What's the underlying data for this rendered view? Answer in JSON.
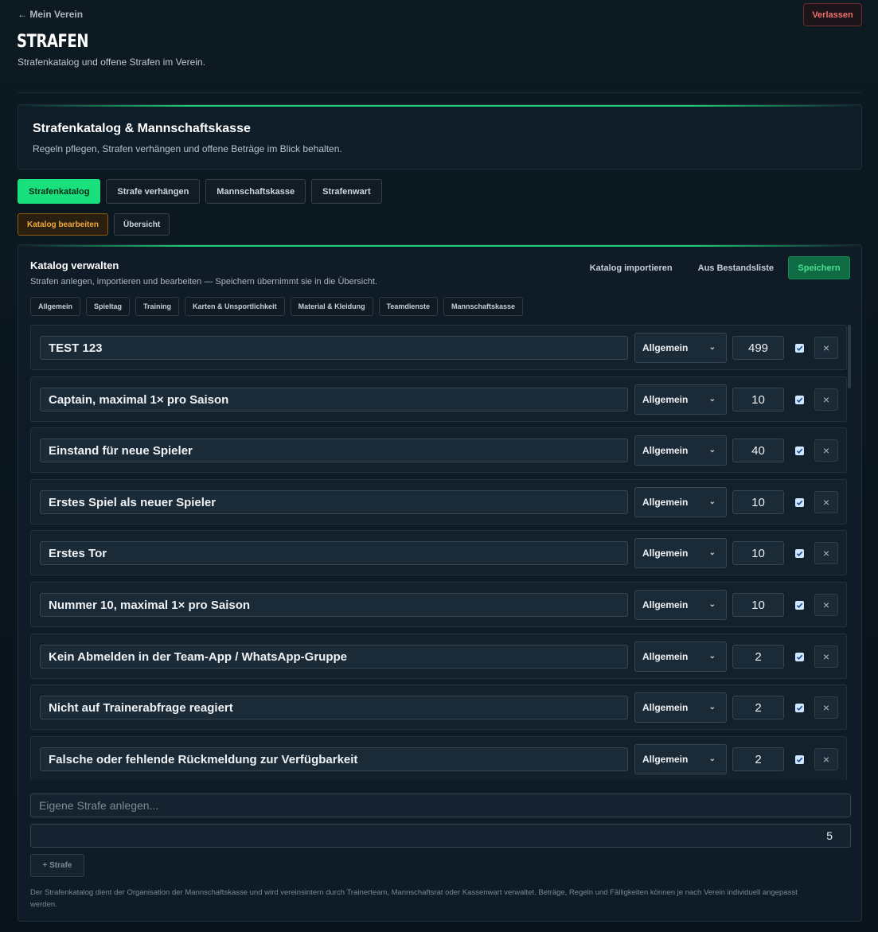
{
  "header": {
    "back_label": "← Mein Verein",
    "leave_label": "Verlassen",
    "title": "STRAFEN",
    "subtitle": "Strafenkatalog und offene Strafen im Verein."
  },
  "hero": {
    "title": "Strafenkatalog & Mannschaftskasse",
    "subtitle": "Regeln pflegen, Strafen verhängen und offene Beträge im Blick behalten."
  },
  "tabs": [
    {
      "label": "Strafenkatalog",
      "active": true
    },
    {
      "label": "Strafe verhängen",
      "active": false
    },
    {
      "label": "Mannschaftskasse",
      "active": false
    },
    {
      "label": "Strafenwart",
      "active": false
    }
  ],
  "subtabs": [
    {
      "label": "Katalog bearbeiten",
      "active": true
    },
    {
      "label": "Übersicht",
      "active": false
    }
  ],
  "panel": {
    "title": "Katalog verwalten",
    "subtitle": "Strafen anlegen, importieren und bearbeiten — Speichern übernimmt sie in die Übersicht.",
    "import_label": "Katalog importieren",
    "existing_label": "Aus Bestandsliste",
    "save_label": "Speichern"
  },
  "categories": [
    "Allgemein",
    "Spieltag",
    "Training",
    "Karten & Unsportlichkeit",
    "Material & Kleidung",
    "Teamdienste",
    "Mannschaftskasse"
  ],
  "penalties": [
    {
      "name": "TEST 123",
      "category": "Allgemein",
      "amount": "499",
      "active": true
    },
    {
      "name": "Captain, maximal 1× pro Saison",
      "category": "Allgemein",
      "amount": "10",
      "active": true
    },
    {
      "name": "Einstand für neue Spieler",
      "category": "Allgemein",
      "amount": "40",
      "active": true
    },
    {
      "name": "Erstes Spiel als neuer Spieler",
      "category": "Allgemein",
      "amount": "10",
      "active": true
    },
    {
      "name": "Erstes Tor",
      "category": "Allgemein",
      "amount": "10",
      "active": true
    },
    {
      "name": "Nummer 10, maximal 1× pro Saison",
      "category": "Allgemein",
      "amount": "10",
      "active": true
    },
    {
      "name": "Kein Abmelden in der Team-App / WhatsApp-Gruppe",
      "category": "Allgemein",
      "amount": "2",
      "active": true
    },
    {
      "name": "Nicht auf Trainerabfrage reagiert",
      "category": "Allgemein",
      "amount": "2",
      "active": true
    },
    {
      "name": "Falsche oder fehlende Rückmeldung zur Verfügbarkeit",
      "category": "Allgemein",
      "amount": "2",
      "active": true
    }
  ],
  "new_penalty": {
    "placeholder": "Eigene Strafe anlegen...",
    "amount": "5",
    "add_label": "+ Strafe"
  },
  "footnote": "Der Strafenkatalog dient der Organisation der Mannschaftskasse und wird vereinsintern durch Trainerteam, Mannschaftsrat oder Kassenwart verwaltet. Beträge, Regeln und Fälligkeiten können je nach Verein individuell angepasst werden.",
  "colors": {
    "accent": "#19e07d",
    "danger": "#f0706b",
    "warning": "#f3a93a",
    "background": "#0d1a22"
  }
}
